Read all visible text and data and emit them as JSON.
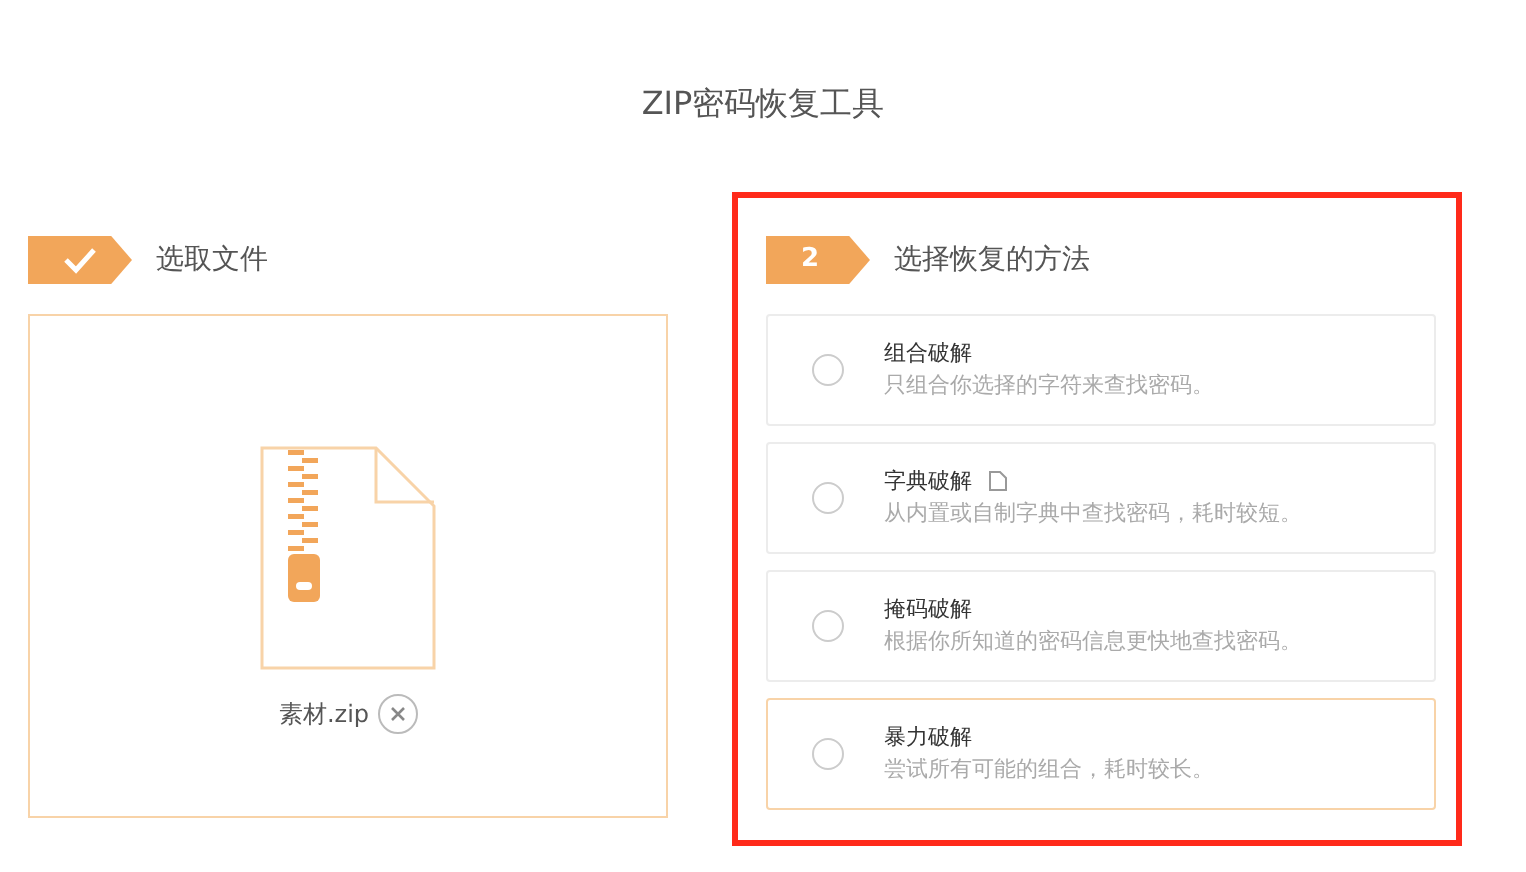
{
  "title": "ZIP密码恢复工具",
  "steps": [
    {
      "kind": "done",
      "label": "选取文件"
    },
    {
      "kind": "number",
      "number": "2",
      "label": "选择恢复的方法"
    }
  ],
  "file": {
    "name": "素材.zip"
  },
  "methods": [
    {
      "name": "组合破解",
      "description": "只组合你选择的字符来查找密码。",
      "selected": false,
      "hovered": false,
      "has_doc_icon": false
    },
    {
      "name": "字典破解",
      "description": "从内置或自制字典中查找密码，耗时较短。",
      "selected": false,
      "hovered": false,
      "has_doc_icon": true
    },
    {
      "name": "掩码破解",
      "description": "根据你所知道的密码信息更快地查找密码。",
      "selected": false,
      "hovered": false,
      "has_doc_icon": false
    },
    {
      "name": "暴力破解",
      "description": "尝试所有可能的组合，耗时较长。",
      "selected": false,
      "hovered": true,
      "has_doc_icon": false
    }
  ]
}
